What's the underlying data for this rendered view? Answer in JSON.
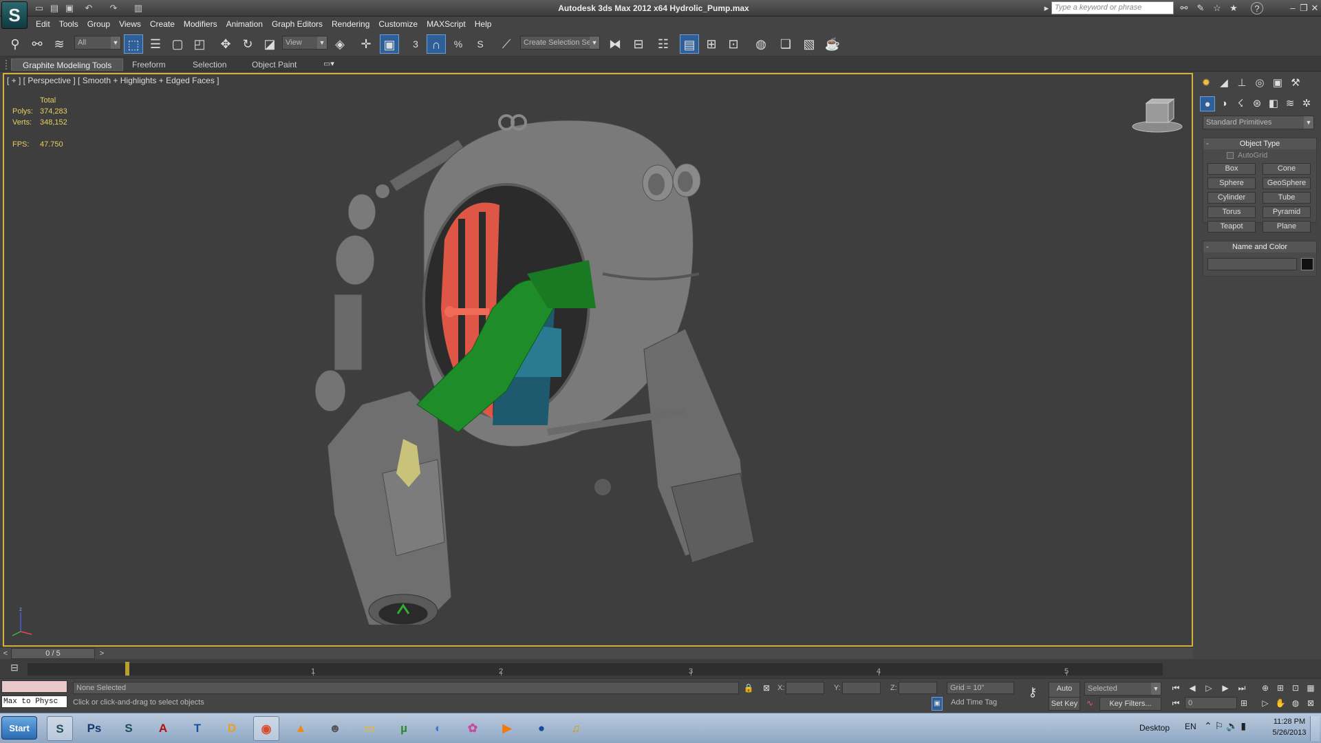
{
  "title_bar": {
    "app_logo": "S",
    "quick_access_icons": [
      "new-file-icon",
      "open-file-icon",
      "save-icon",
      "undo-icon",
      "redo-icon",
      "project-folder-icon"
    ],
    "title": "Autodesk 3ds Max  2012 x64      Hydrolic_Pump.max",
    "search_placeholder": "Type a keyword or phrase",
    "help": "?",
    "window_controls": [
      "–",
      "❐",
      "✕"
    ]
  },
  "menus": [
    "Edit",
    "Tools",
    "Group",
    "Views",
    "Create",
    "Modifiers",
    "Animation",
    "Graph Editors",
    "Rendering",
    "Customize",
    "MAXScript",
    "Help"
  ],
  "toolbar": {
    "selection_filter": "All",
    "reference_coord": "View",
    "named_selection": "Create Selection Se",
    "snaps": {
      "snap": "3",
      "percent": "%",
      "spinner": "S"
    }
  },
  "ribbon_tabs": [
    "Graphite Modeling Tools",
    "Freeform",
    "Selection",
    "Object Paint"
  ],
  "viewport": {
    "label": "[ + ] [ Perspective ] [ Smooth + Highlights + Edged Faces ]",
    "stats": {
      "total_label": "Total",
      "polys_label": "Polys:",
      "polys": "374,283",
      "verts_label": "Verts:",
      "verts": "348,152",
      "fps_label": "FPS:",
      "fps": "47.750"
    }
  },
  "command_panel": {
    "category": "Standard Primitives",
    "object_type_title": "Object Type",
    "autogrid": "AutoGrid",
    "primitives": [
      "Box",
      "Cone",
      "Sphere",
      "GeoSphere",
      "Cylinder",
      "Tube",
      "Torus",
      "Pyramid",
      "Teapot",
      "Plane"
    ],
    "name_color_title": "Name and Color",
    "rollout_toggle": "-"
  },
  "time_slider": {
    "frame": "0 / 5",
    "prev": "<",
    "next": ">"
  },
  "track_ticks": [
    "1",
    "2",
    "3",
    "4",
    "5"
  ],
  "status": {
    "selection": "None Selected",
    "prompt": "Click or click-and-drag to select objects",
    "script_listener": "Max to Physc",
    "x_label": "X:",
    "y_label": "Y:",
    "z_label": "Z:",
    "grid": "Grid = 10\"",
    "auto_key": "Auto Key",
    "set_key": "Set Key",
    "key_mode": "Selected",
    "key_filters": "Key Filters...",
    "add_time_tag": "Add Time Tag",
    "current_frame": "0"
  },
  "taskbar": {
    "start": "Start",
    "apps": [
      {
        "name": "3ds-max-icon",
        "glyph": "S",
        "color": "#1d4f55"
      },
      {
        "name": "photoshop-icon",
        "glyph": "Ps",
        "color": "#123a6b"
      },
      {
        "name": "3ds-max-icon-2",
        "glyph": "S",
        "color": "#1d4f55"
      },
      {
        "name": "acrobat-icon",
        "glyph": "A",
        "color": "#b01010"
      },
      {
        "name": "app-blue-icon",
        "glyph": "T",
        "color": "#1a4fa0"
      },
      {
        "name": "dlink-icon",
        "glyph": "D",
        "color": "#e8a020"
      },
      {
        "name": "chrome-icon",
        "glyph": "◉",
        "color": "#d84a2a"
      },
      {
        "name": "vlc-icon",
        "glyph": "▲",
        "color": "#f08a10"
      },
      {
        "name": "alien-icon",
        "glyph": "☻",
        "color": "#555"
      },
      {
        "name": "folder-icon",
        "glyph": "▭",
        "color": "#d8b850"
      },
      {
        "name": "utorrent-icon",
        "glyph": "µ",
        "color": "#2a8a2a"
      },
      {
        "name": "app-globe-icon",
        "glyph": "◐",
        "color": "#3a7ad0"
      },
      {
        "name": "picasa-icon",
        "glyph": "✿",
        "color": "#c84aa0"
      },
      {
        "name": "media-player-icon",
        "glyph": "▶",
        "color": "#f07a10"
      },
      {
        "name": "google-earth-icon",
        "glyph": "●",
        "color": "#1a4a9a"
      },
      {
        "name": "headphones-icon",
        "glyph": "♫",
        "color": "#d0a000"
      }
    ],
    "desktop": "Desktop",
    "lang": "EN",
    "time": "11:28 PM",
    "date": "5/26/2013"
  }
}
